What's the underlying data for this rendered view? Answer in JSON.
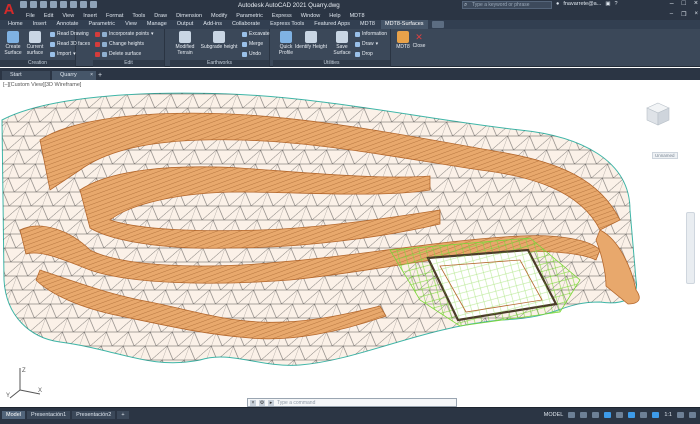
{
  "titlebar": {
    "app_logo": "A",
    "title": "Autodesk AutoCAD 2021   Quarry.dwg",
    "search_placeholder": "Type a keyword or phrase",
    "user": "fnavarrete@a...",
    "window_controls": [
      "–",
      "□",
      "×"
    ]
  },
  "menu": {
    "items": [
      "File",
      "Edit",
      "View",
      "Insert",
      "Format",
      "Tools",
      "Draw",
      "Dimension",
      "Modify",
      "Parametric",
      "Express",
      "Window",
      "Help",
      "MDT8"
    ]
  },
  "ribbon_tabs": [
    "Home",
    "Insert",
    "Annotate",
    "Parametric",
    "View",
    "Manage",
    "Output",
    "Add-ins",
    "Collaborate",
    "Express Tools",
    "Featured Apps",
    "MDT8",
    "MDT8-Surfaces"
  ],
  "ribbon_active_tab": "MDT8-Surfaces",
  "ribbon": {
    "creation": {
      "title": "Creation",
      "create_surface": "Create\nSurface",
      "current_surface": "Current\nsurface",
      "read_drawing": "Read Drawing",
      "read_3d_faces": "Read 3D faces",
      "import": "Import"
    },
    "edit": {
      "title": "Edit",
      "incorporate_points": "Incorporate points",
      "change_heights": "Change heights",
      "delete_surface": "Delete surface"
    },
    "earthworks": {
      "title": "Earthworks",
      "modified_terrain": "Modified\nTerrain",
      "subgrade_height": "Subgrade height",
      "excavate": "Excavate",
      "merge": "Merge",
      "undo": "Undo"
    },
    "utilities": {
      "title": "Utilities",
      "quick_profile": "Quick\nProfile",
      "identify_height": "Identify Height",
      "save_surface": "Save\nSurface",
      "information": "Information",
      "draw": "Draw",
      "drop": "Drop"
    },
    "mdt8": {
      "mdt8": "MDT8",
      "close": "Close"
    }
  },
  "file_tabs": [
    {
      "label": "Start",
      "active": false
    },
    {
      "label": "Quarry",
      "active": true
    }
  ],
  "viewport": {
    "label": "[–][Custom View][3D Wireframe]",
    "unnamed": "Unnamed"
  },
  "command_line": {
    "placeholder": "Type a command"
  },
  "status": {
    "layout_tabs": [
      "Model",
      "Presentación1",
      "Presentación2"
    ],
    "model_label": "MODEL",
    "scale": "1:1"
  },
  "colors": {
    "terrain_fill": "#e8a86c",
    "terrain_dark": "#b4682e",
    "mesh_line": "#2d2d2d",
    "boundary": "#3fb6a8",
    "platform": "#7cd63a",
    "accent_red": "#d42a2a"
  }
}
